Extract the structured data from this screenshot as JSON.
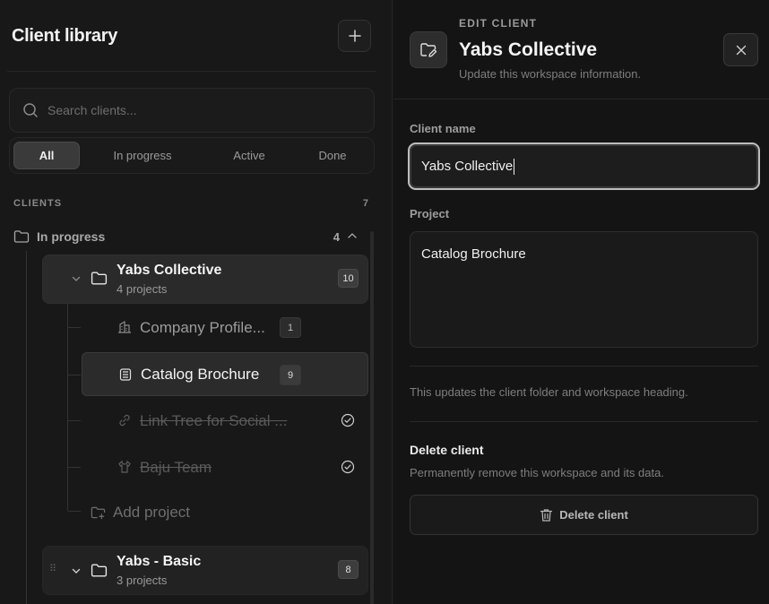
{
  "sidebar": {
    "title": "Client library",
    "search_placeholder": "Search clients...",
    "filters": [
      "All",
      "In progress",
      "Active",
      "Done"
    ],
    "active_filter": "All",
    "section_label": "CLIENTS",
    "section_count": "7",
    "group": {
      "label": "In progress",
      "count": "4"
    },
    "clients": [
      {
        "name": "Yabs Collective",
        "subtitle": "4 projects",
        "badge": "10",
        "expanded": true,
        "projects": [
          {
            "name": "Company Profile...",
            "badge": "1",
            "icon": "building-icon",
            "done": false,
            "selected": false
          },
          {
            "name": "Catalog Brochure",
            "badge": "9",
            "icon": "book-icon",
            "done": false,
            "selected": true
          },
          {
            "name": "Link Tree for Social ...",
            "icon": "link-icon",
            "done": true,
            "selected": false
          },
          {
            "name": "Baju Team",
            "icon": "shirt-icon",
            "done": true,
            "selected": false
          }
        ],
        "add_project_label": "Add project"
      },
      {
        "name": "Yabs - Basic",
        "subtitle": "3 projects",
        "badge": "8",
        "expanded": false
      }
    ]
  },
  "panel": {
    "kicker": "EDIT CLIENT",
    "title": "Yabs Collective",
    "subtitle": "Update this workspace information.",
    "client_name_label": "Client name",
    "client_name_value": "Yabs Collective",
    "project_label": "Project",
    "project_value": "Catalog Brochure",
    "note": "This updates the client folder and workspace heading.",
    "delete_heading": "Delete client",
    "delete_description": "Permanently remove this workspace and its data.",
    "delete_button": "Delete client"
  },
  "colors": {
    "background": "#161616",
    "surface": "#2a2a2a",
    "text": "#f4f4f4",
    "muted": "#7e7e7e"
  }
}
